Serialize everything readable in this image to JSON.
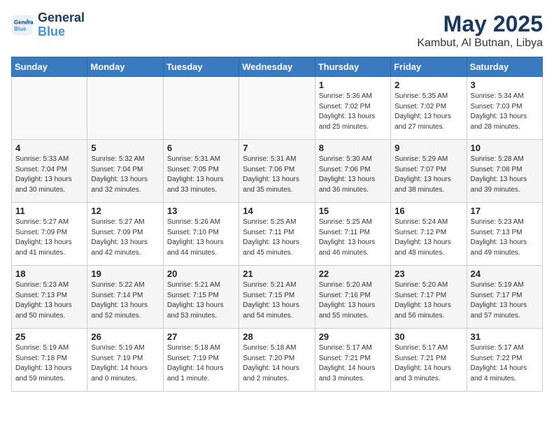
{
  "logo": {
    "line1": "General",
    "line2": "Blue"
  },
  "title": "May 2025",
  "location": "Kambut, Al Butnan, Libya",
  "weekdays": [
    "Sunday",
    "Monday",
    "Tuesday",
    "Wednesday",
    "Thursday",
    "Friday",
    "Saturday"
  ],
  "weeks": [
    [
      {
        "day": "",
        "info": ""
      },
      {
        "day": "",
        "info": ""
      },
      {
        "day": "",
        "info": ""
      },
      {
        "day": "",
        "info": ""
      },
      {
        "day": "1",
        "info": "Sunrise: 5:36 AM\nSunset: 7:02 PM\nDaylight: 13 hours\nand 25 minutes."
      },
      {
        "day": "2",
        "info": "Sunrise: 5:35 AM\nSunset: 7:02 PM\nDaylight: 13 hours\nand 27 minutes."
      },
      {
        "day": "3",
        "info": "Sunrise: 5:34 AM\nSunset: 7:03 PM\nDaylight: 13 hours\nand 28 minutes."
      }
    ],
    [
      {
        "day": "4",
        "info": "Sunrise: 5:33 AM\nSunset: 7:04 PM\nDaylight: 13 hours\nand 30 minutes."
      },
      {
        "day": "5",
        "info": "Sunrise: 5:32 AM\nSunset: 7:04 PM\nDaylight: 13 hours\nand 32 minutes."
      },
      {
        "day": "6",
        "info": "Sunrise: 5:31 AM\nSunset: 7:05 PM\nDaylight: 13 hours\nand 33 minutes."
      },
      {
        "day": "7",
        "info": "Sunrise: 5:31 AM\nSunset: 7:06 PM\nDaylight: 13 hours\nand 35 minutes."
      },
      {
        "day": "8",
        "info": "Sunrise: 5:30 AM\nSunset: 7:06 PM\nDaylight: 13 hours\nand 36 minutes."
      },
      {
        "day": "9",
        "info": "Sunrise: 5:29 AM\nSunset: 7:07 PM\nDaylight: 13 hours\nand 38 minutes."
      },
      {
        "day": "10",
        "info": "Sunrise: 5:28 AM\nSunset: 7:08 PM\nDaylight: 13 hours\nand 39 minutes."
      }
    ],
    [
      {
        "day": "11",
        "info": "Sunrise: 5:27 AM\nSunset: 7:09 PM\nDaylight: 13 hours\nand 41 minutes."
      },
      {
        "day": "12",
        "info": "Sunrise: 5:27 AM\nSunset: 7:09 PM\nDaylight: 13 hours\nand 42 minutes."
      },
      {
        "day": "13",
        "info": "Sunrise: 5:26 AM\nSunset: 7:10 PM\nDaylight: 13 hours\nand 44 minutes."
      },
      {
        "day": "14",
        "info": "Sunrise: 5:25 AM\nSunset: 7:11 PM\nDaylight: 13 hours\nand 45 minutes."
      },
      {
        "day": "15",
        "info": "Sunrise: 5:25 AM\nSunset: 7:11 PM\nDaylight: 13 hours\nand 46 minutes."
      },
      {
        "day": "16",
        "info": "Sunrise: 5:24 AM\nSunset: 7:12 PM\nDaylight: 13 hours\nand 48 minutes."
      },
      {
        "day": "17",
        "info": "Sunrise: 5:23 AM\nSunset: 7:13 PM\nDaylight: 13 hours\nand 49 minutes."
      }
    ],
    [
      {
        "day": "18",
        "info": "Sunrise: 5:23 AM\nSunset: 7:13 PM\nDaylight: 13 hours\nand 50 minutes."
      },
      {
        "day": "19",
        "info": "Sunrise: 5:22 AM\nSunset: 7:14 PM\nDaylight: 13 hours\nand 52 minutes."
      },
      {
        "day": "20",
        "info": "Sunrise: 5:21 AM\nSunset: 7:15 PM\nDaylight: 13 hours\nand 53 minutes."
      },
      {
        "day": "21",
        "info": "Sunrise: 5:21 AM\nSunset: 7:15 PM\nDaylight: 13 hours\nand 54 minutes."
      },
      {
        "day": "22",
        "info": "Sunrise: 5:20 AM\nSunset: 7:16 PM\nDaylight: 13 hours\nand 55 minutes."
      },
      {
        "day": "23",
        "info": "Sunrise: 5:20 AM\nSunset: 7:17 PM\nDaylight: 13 hours\nand 56 minutes."
      },
      {
        "day": "24",
        "info": "Sunrise: 5:19 AM\nSunset: 7:17 PM\nDaylight: 13 hours\nand 57 minutes."
      }
    ],
    [
      {
        "day": "25",
        "info": "Sunrise: 5:19 AM\nSunset: 7:18 PM\nDaylight: 13 hours\nand 59 minutes."
      },
      {
        "day": "26",
        "info": "Sunrise: 5:19 AM\nSunset: 7:19 PM\nDaylight: 14 hours\nand 0 minutes."
      },
      {
        "day": "27",
        "info": "Sunrise: 5:18 AM\nSunset: 7:19 PM\nDaylight: 14 hours\nand 1 minute."
      },
      {
        "day": "28",
        "info": "Sunrise: 5:18 AM\nSunset: 7:20 PM\nDaylight: 14 hours\nand 2 minutes."
      },
      {
        "day": "29",
        "info": "Sunrise: 5:17 AM\nSunset: 7:21 PM\nDaylight: 14 hours\nand 3 minutes."
      },
      {
        "day": "30",
        "info": "Sunrise: 5:17 AM\nSunset: 7:21 PM\nDaylight: 14 hours\nand 3 minutes."
      },
      {
        "day": "31",
        "info": "Sunrise: 5:17 AM\nSunset: 7:22 PM\nDaylight: 14 hours\nand 4 minutes."
      }
    ]
  ]
}
